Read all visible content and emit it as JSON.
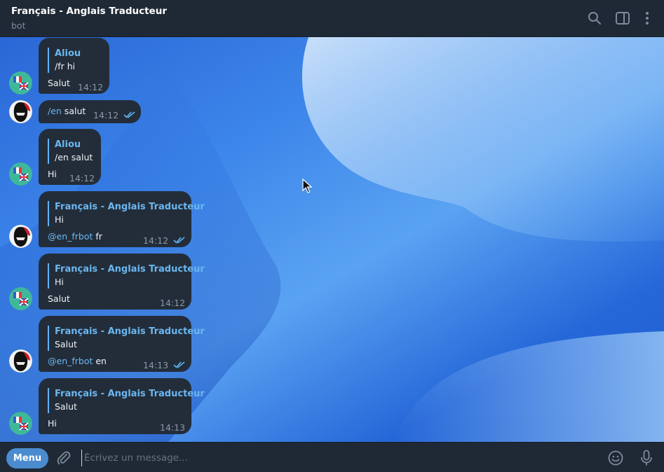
{
  "header": {
    "title": "Français - Anglais Traducteur",
    "subtitle": "bot"
  },
  "messages": [
    {
      "reply_name": "Aliou",
      "reply_text": "/fr hi",
      "text": "Salut",
      "time": "14:12"
    },
    {
      "cmd": "/en",
      "text": " salut",
      "time": "14:12"
    },
    {
      "reply_name": "Aliou",
      "reply_text": "/en salut",
      "text": "Hi",
      "time": "14:12"
    },
    {
      "reply_name": "Français - Anglais Traducteur",
      "reply_text": "Hi",
      "cmd": "@en_frbot",
      "text": " fr",
      "time": "14:12"
    },
    {
      "reply_name": "Français - Anglais Traducteur",
      "reply_text": "Hi",
      "text": "Salut",
      "time": "14:12"
    },
    {
      "reply_name": "Français - Anglais Traducteur",
      "reply_text": "Salut",
      "cmd": "@en_frbot",
      "text": " en",
      "time": "14:13"
    },
    {
      "reply_name": "Français - Anglais Traducteur",
      "reply_text": "Salut",
      "text": "Hi",
      "time": "14:13"
    }
  ],
  "composer": {
    "menu_label": "Menu",
    "placeholder": "Écrivez un message..."
  },
  "colors": {
    "accent": "#6ab7f0",
    "bubble": "#232d3a",
    "menu": "#4a8ccf"
  },
  "icons": [
    "search-icon",
    "sidebar-toggle-icon",
    "more-icon",
    "attach-icon",
    "emoji-icon",
    "mic-icon",
    "read-ticks-icon"
  ]
}
